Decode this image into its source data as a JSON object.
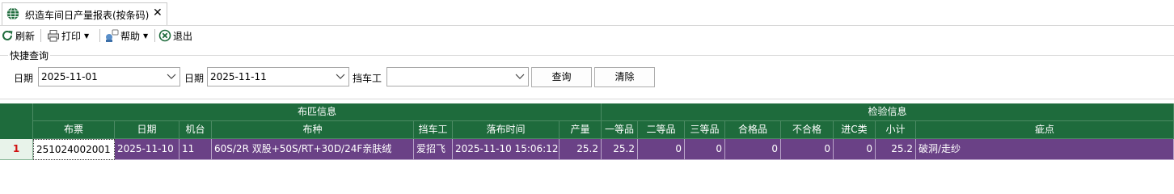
{
  "tab": {
    "title": "织造车间日产量报表(按条码)",
    "icon": "globe-icon",
    "close_glyph": "✕"
  },
  "toolbar": {
    "refresh": "刷新",
    "print": "打印",
    "help": "帮助",
    "exit": "退出"
  },
  "quick_search": {
    "title": "快捷查询",
    "date_from_label": "日期",
    "date_from_value": "2025-11-01",
    "date_to_label": "日期",
    "date_to_value": "2025-11-11",
    "operator_label": "挡车工",
    "operator_value": "",
    "query_button": "查询",
    "clear_button": "清除"
  },
  "grid": {
    "group_headers": {
      "fabric_info": "布匹信息",
      "inspection_info": "检验信息"
    },
    "columns": {
      "ticket": "布票",
      "date": "日期",
      "machine": "机台",
      "fabric_type": "布种",
      "operator": "挡车工",
      "doff_time": "落布时间",
      "output": "产量",
      "grade1": "一等品",
      "grade2": "二等品",
      "grade3": "三等品",
      "qualified": "合格品",
      "unqualified": "不合格",
      "grade_c": "进C类",
      "subtotal": "小计",
      "defect": "疵点"
    },
    "rows": [
      {
        "row_number": "1",
        "ticket": "251024002001",
        "date": "2025-11-10",
        "machine": "11",
        "fabric_type": "60S/2R 双股+50S/RT+30D/24F亲肤绒",
        "operator": "爱招飞",
        "doff_time": "2025-11-10 15:06:12",
        "output": "25.2",
        "grade1": "25.2",
        "grade2": "0",
        "grade3": "0",
        "qualified": "0",
        "unqualified": "0",
        "grade_c": "0",
        "subtotal": "25.2",
        "defect": "破洞/走纱"
      }
    ]
  },
  "colors": {
    "header_green": "#1e6b3c",
    "row_purple": "#6a4186",
    "row_number_red": "#d01010"
  }
}
